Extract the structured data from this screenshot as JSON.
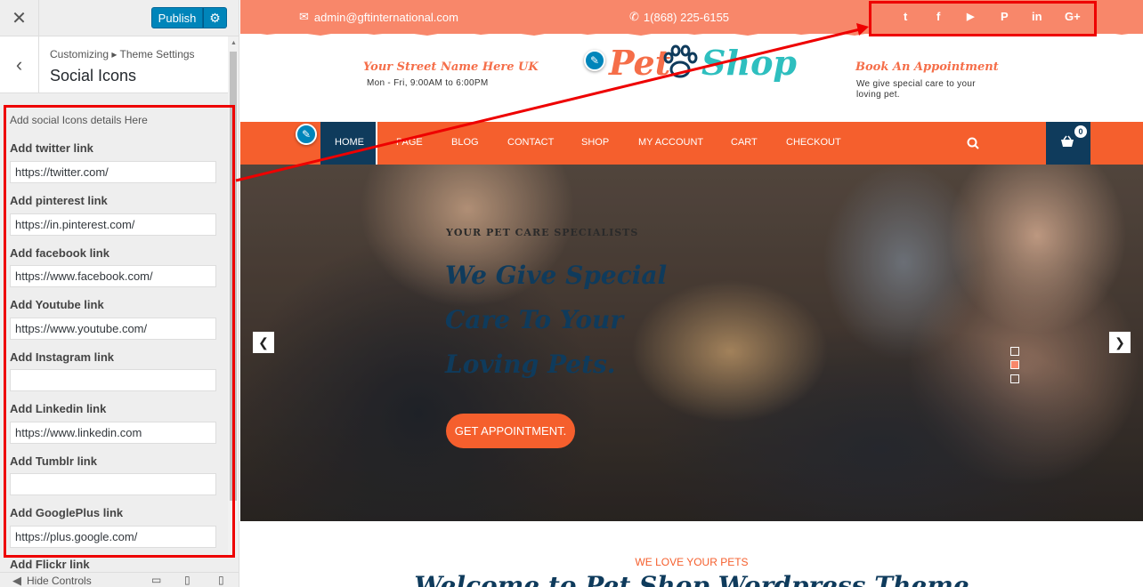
{
  "customizer": {
    "close_glyph": "✕",
    "publish_label": "Publish",
    "gear_glyph": "⚙",
    "back_glyph": "‹",
    "breadcrumb": "Customizing ▸ Theme Settings",
    "section_title": "Social Icons",
    "description": "Add social Icons details Here",
    "fields": [
      {
        "label": "Add twitter link",
        "value": "https://twitter.com/"
      },
      {
        "label": "Add pinterest link",
        "value": "https://in.pinterest.com/"
      },
      {
        "label": "Add facebook link",
        "value": "https://www.facebook.com/"
      },
      {
        "label": "Add Youtube link",
        "value": "https://www.youtube.com/"
      },
      {
        "label": "Add Instagram link",
        "value": ""
      },
      {
        "label": "Add Linkedin link",
        "value": "https://www.linkedin.com"
      },
      {
        "label": "Add Tumblr link",
        "value": ""
      },
      {
        "label": "Add GooglePlus link",
        "value": "https://plus.google.com/"
      },
      {
        "label": "Add Flickr link",
        "value": ""
      }
    ],
    "hide_controls_label": "Hide Controls"
  },
  "site": {
    "topbar": {
      "email": "admin@gftinternational.com",
      "phone": "1(868) 225-6155",
      "social": [
        "t",
        "f",
        "▶",
        "P",
        "in",
        "G+"
      ]
    },
    "header": {
      "address_title": "Your Street Name Here UK",
      "address_sub": "Mon - Fri, 9:00AM to 6:00PM",
      "logo_left": "Pet",
      "logo_right": "Shop",
      "appointment_title": "Book An Appointment",
      "appointment_sub": "We give special care to your loving pet."
    },
    "nav": {
      "items": [
        "HOME",
        "PAGE",
        "BLOG",
        "CONTACT",
        "SHOP",
        "MY ACCOUNT",
        "CART",
        "CHECKOUT"
      ],
      "cart_count": "0"
    },
    "hero": {
      "kicker": "Your Pet Care Specialists",
      "title": "We Give Special Care To Your Loving Pets.",
      "button": "GET APPOINTMENT.",
      "slides": 3,
      "active_slide": 2
    },
    "intro": {
      "kicker": "WE LOVE YOUR PETS",
      "title": "Welcome to Pet Shop Wordpress Theme"
    }
  },
  "colors": {
    "accent": "#f55f2d",
    "topbar": "#f8876a",
    "navy": "#0f3b5c",
    "wp_blue": "#0085ba",
    "annotation_red": "#e00"
  }
}
